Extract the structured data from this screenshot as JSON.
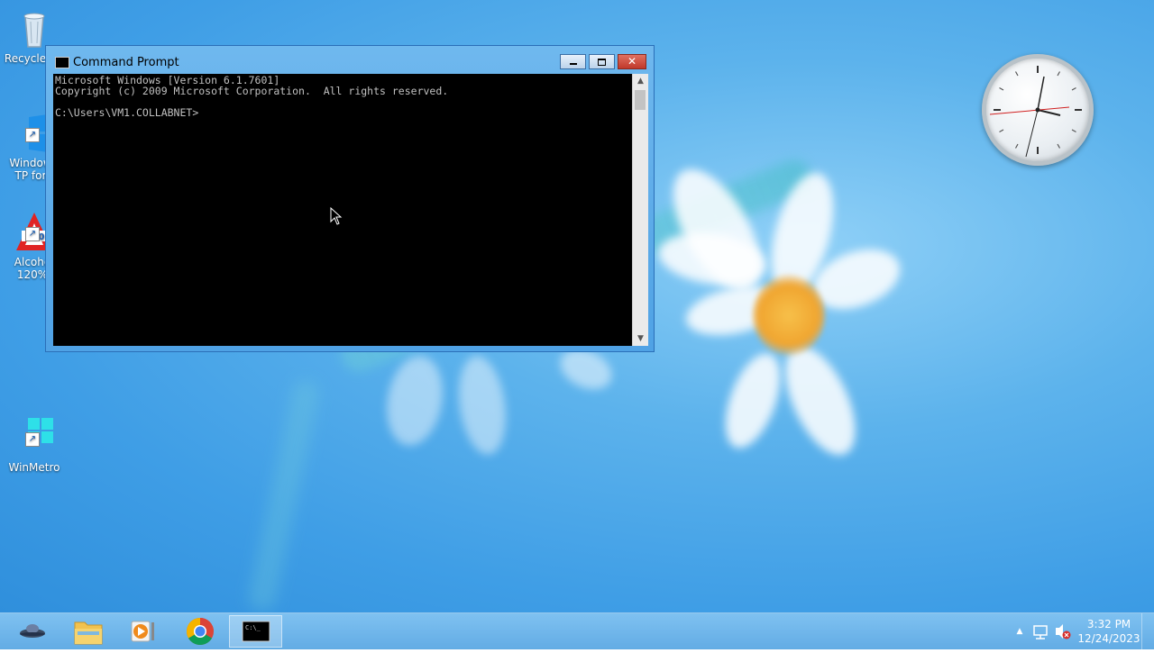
{
  "desktop": {
    "icons": [
      {
        "label": "Recycle",
        "icon": "recycle-bin-icon"
      },
      {
        "label": "Window\nTP for",
        "icon": "windows-shortcut-icon"
      },
      {
        "label": "Alcoho\n120%",
        "icon": "alcohol-120-icon"
      },
      {
        "label": "WinMetro",
        "icon": "windows-logo-icon"
      }
    ]
  },
  "window": {
    "title": "Command Prompt",
    "console_lines": "Microsoft Windows [Version 6.1.7601]\nCopyright (c) 2009 Microsoft Corporation.  All rights reserved.\n\nC:\\Users\\VM1.COLLABNET>",
    "buttons": {
      "minimize": "minimize",
      "maximize": "maximize",
      "close": "close"
    }
  },
  "taskbar": {
    "apps": [
      {
        "name": "ufo-app",
        "icon": "ufo-icon"
      },
      {
        "name": "file-explorer",
        "icon": "folder-icon"
      },
      {
        "name": "media-player",
        "icon": "media-player-icon"
      },
      {
        "name": "chrome",
        "icon": "chrome-icon"
      },
      {
        "name": "command-prompt",
        "icon": "cmd-icon",
        "active": true
      }
    ],
    "tray": {
      "time": "3:32 PM",
      "date": "12/24/2023"
    }
  },
  "colors": {
    "accent": "#4fa2e5",
    "console_bg": "#000000",
    "console_fg": "#c0c0c0"
  }
}
